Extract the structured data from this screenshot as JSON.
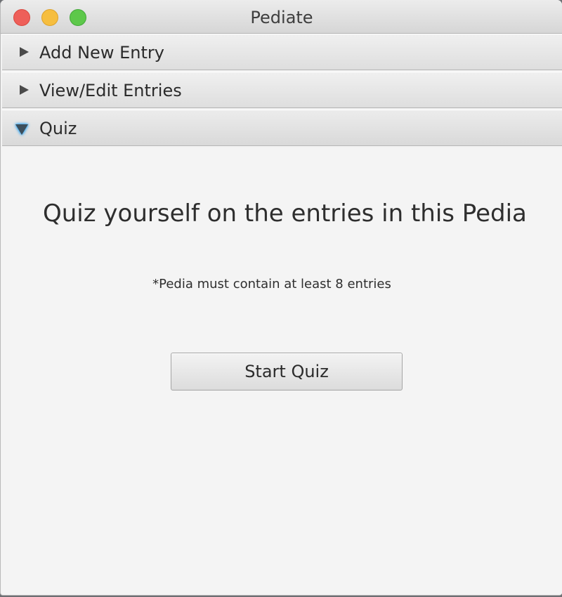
{
  "window": {
    "title": "Pediate"
  },
  "accordion": {
    "panes": [
      {
        "label": "Add New Entry",
        "expanded": false
      },
      {
        "label": "View/Edit Entries",
        "expanded": false
      },
      {
        "label": "Quiz",
        "expanded": true
      }
    ]
  },
  "quiz": {
    "heading": "Quiz yourself on the entries in this Pedia",
    "note": "*Pedia must contain at least 8 entries",
    "start_label": "Start Quiz"
  },
  "colors": {
    "focus_accent": "#39a9f3",
    "close": "#ee5f59",
    "minimize": "#f6be3f",
    "maximize": "#5dc84a"
  }
}
